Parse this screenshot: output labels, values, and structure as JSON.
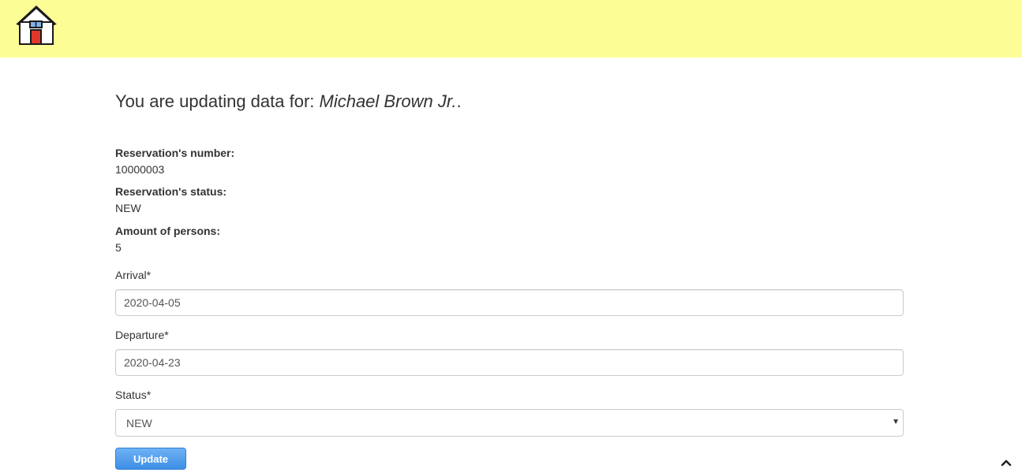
{
  "header": {
    "home_icon": "house-icon",
    "background_color": "#fdfd96"
  },
  "main": {
    "heading_prefix": "You are updating data for: ",
    "guest_name": "Michael Brown Jr.",
    "heading_suffix": ".",
    "reservation_number_label": "Reservation's number:",
    "reservation_number": "10000003",
    "reservation_status_label": "Reservation's status:",
    "reservation_status": "NEW",
    "persons_label": "Amount of persons:",
    "persons": "5",
    "arrival_label": "Arrival*",
    "arrival_value": "2020-04-05",
    "departure_label": "Departure*",
    "departure_value": "2020-04-23",
    "status_label": "Status*",
    "status_selected": "NEW",
    "update_label": "Update"
  },
  "footer": {
    "scroll_top_icon": "chevron-up-icon"
  },
  "colors": {
    "button_blue": "#3d8fe6",
    "door_red": "#e0392b",
    "window_blue": "#7fb3e6"
  }
}
